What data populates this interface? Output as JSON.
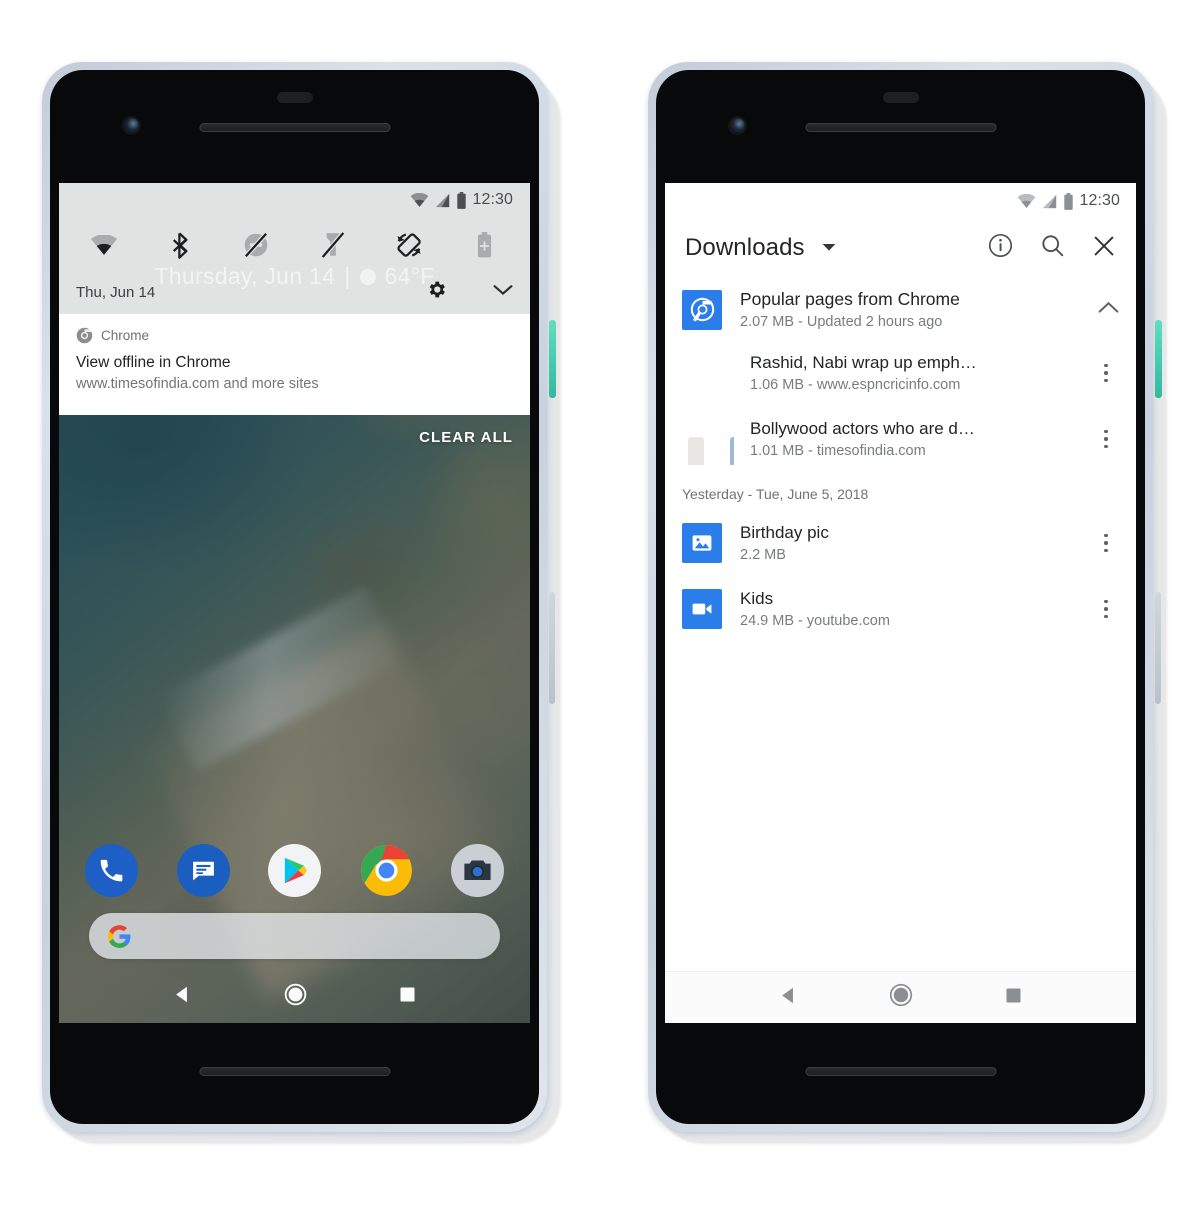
{
  "left_phone": {
    "status_bar": {
      "time": "12:30",
      "icons": [
        "wifi-icon",
        "signal-icon",
        "battery-icon"
      ]
    },
    "quick_settings": {
      "toggles": [
        {
          "name": "wifi-toggle",
          "label": "Wi-Fi"
        },
        {
          "name": "bluetooth-toggle",
          "label": "Bluetooth"
        },
        {
          "name": "do-not-disturb-toggle",
          "label": "Do Not Disturb"
        },
        {
          "name": "flashlight-toggle",
          "label": "Flashlight"
        },
        {
          "name": "auto-rotate-toggle",
          "label": "Auto-rotate"
        },
        {
          "name": "battery-saver-toggle",
          "label": "Battery Saver"
        }
      ],
      "ghost_text_left": "Thursday, Jun 14",
      "ghost_separator": "|",
      "ghost_text_right": "64°F",
      "date": "Thu, Jun 14",
      "settings_icon": "gear-icon",
      "expand_icon": "chevron-down-icon"
    },
    "notification": {
      "app_icon": "chrome-icon",
      "app_name": "Chrome",
      "title": "View offline in Chrome",
      "body": "www.timesofindia.com and more sites"
    },
    "clear_all_label": "CLEAR ALL",
    "dock": [
      {
        "name": "phone-app-icon",
        "label": "Phone"
      },
      {
        "name": "messages-app-icon",
        "label": "Messages"
      },
      {
        "name": "play-store-app-icon",
        "label": "Play Store"
      },
      {
        "name": "chrome-app-icon",
        "label": "Chrome"
      },
      {
        "name": "camera-app-icon",
        "label": "Camera"
      }
    ],
    "search_bar": {
      "icon": "google-g-icon",
      "value": ""
    },
    "nav_bar": [
      {
        "name": "nav-back-button",
        "label": "Back"
      },
      {
        "name": "nav-home-button",
        "label": "Home"
      },
      {
        "name": "nav-recents-button",
        "label": "Recents"
      }
    ]
  },
  "right_phone": {
    "status_bar": {
      "time": "12:30",
      "icons": [
        "wifi-icon",
        "signal-icon",
        "battery-icon"
      ]
    },
    "app_bar": {
      "title": "Downloads",
      "dropdown_icon": "caret-down-icon",
      "actions": [
        {
          "name": "info-button",
          "icon": "info-circle-icon",
          "label": "Info"
        },
        {
          "name": "search-button",
          "icon": "search-icon",
          "label": "Search"
        },
        {
          "name": "close-button",
          "icon": "close-x-icon",
          "label": "Close"
        }
      ]
    },
    "group": {
      "icon": "chrome-icon",
      "title": "Popular pages from Chrome",
      "subtitle": "2.07 MB - Updated 2 hours ago",
      "collapse_icon": "chevron-up-icon"
    },
    "group_items": [
      {
        "thumbnail": "cricket-photo-thumbnail",
        "title": "Rashid, Nabi wrap up emph…",
        "subtitle": "1.06 MB - www.espncricinfo.com",
        "overflow_icon": "more-vertical-icon"
      },
      {
        "thumbnail": "people-photo-thumbnail",
        "title": "Bollywood actors who are d…",
        "subtitle": "1.01 MB - timesofindia.com",
        "overflow_icon": "more-vertical-icon"
      }
    ],
    "section_label": "Yesterday - Tue, June 5, 2018",
    "items": [
      {
        "icon": "image-file-icon",
        "title": "Birthday pic",
        "subtitle": "2.2 MB",
        "overflow_icon": "more-vertical-icon"
      },
      {
        "icon": "video-file-icon",
        "title": "Kids",
        "subtitle": "24.9 MB - youtube.com",
        "overflow_icon": "more-vertical-icon"
      }
    ],
    "nav_bar": [
      {
        "name": "nav-back-button",
        "label": "Back"
      },
      {
        "name": "nav-home-button",
        "label": "Home"
      },
      {
        "name": "nav-recents-button",
        "label": "Recents"
      }
    ]
  },
  "colors": {
    "accent_blue": "#2b7de9",
    "quick_settings_bg": "#dfe3e2",
    "power_button": "#3fc9ae",
    "text_primary": "#222426",
    "text_secondary": "#787c80"
  }
}
